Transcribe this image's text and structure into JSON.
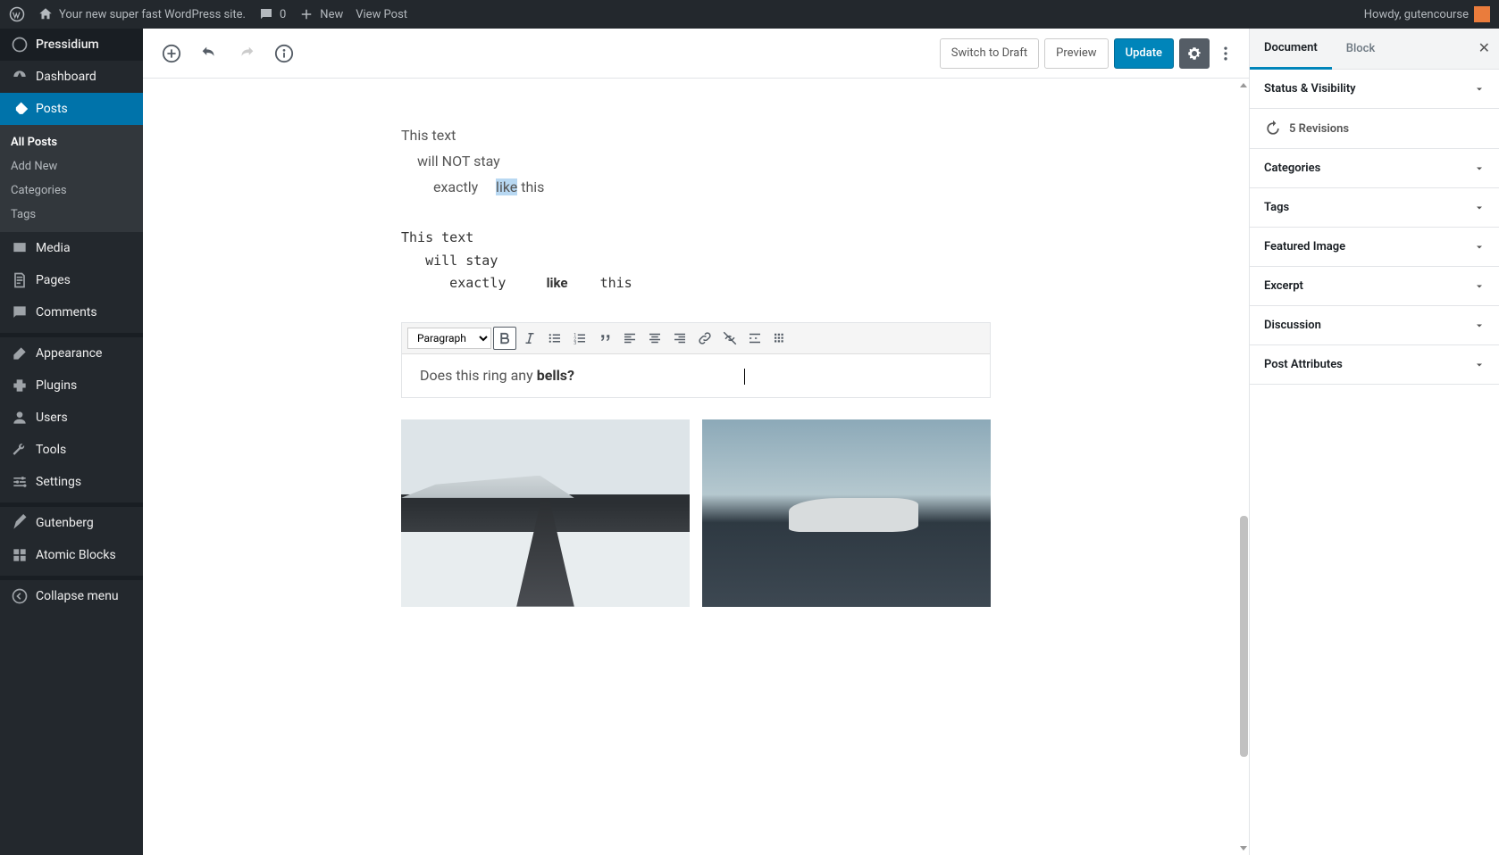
{
  "adminbar": {
    "site_name": "Your new super fast WordPress site.",
    "comments": "0",
    "new": "New",
    "view_post": "View Post",
    "howdy": "Howdy, gutencourse"
  },
  "sidebar": {
    "brand": "Pressidium",
    "items": [
      {
        "label": "Dashboard",
        "icon": "dashboard"
      },
      {
        "label": "Posts",
        "icon": "pin",
        "active": true,
        "subs": [
          {
            "label": "All Posts",
            "active": true
          },
          {
            "label": "Add New"
          },
          {
            "label": "Categories"
          },
          {
            "label": "Tags"
          }
        ]
      },
      {
        "label": "Media",
        "icon": "media"
      },
      {
        "label": "Pages",
        "icon": "pages"
      },
      {
        "label": "Comments",
        "icon": "comment"
      },
      {
        "label": "Appearance",
        "icon": "brush",
        "sep": true
      },
      {
        "label": "Plugins",
        "icon": "plug"
      },
      {
        "label": "Users",
        "icon": "user"
      },
      {
        "label": "Tools",
        "icon": "wrench"
      },
      {
        "label": "Settings",
        "icon": "sliders"
      },
      {
        "label": "Gutenberg",
        "icon": "pencil",
        "sep": true
      },
      {
        "label": "Atomic Blocks",
        "icon": "grid"
      },
      {
        "label": "Collapse menu",
        "icon": "collapse"
      }
    ]
  },
  "toolbar": {
    "switch_draft": "Switch to Draft",
    "preview": "Preview",
    "update": "Update"
  },
  "content": {
    "para1": {
      "l1": "This text",
      "l2": "will NOT stay",
      "l3a": "exactly",
      "l3b_hl": "like",
      "l3c": " this"
    },
    "verse": "This text\n   will stay\n      exactly     <b>like</b>    this",
    "classic": {
      "format": "Paragraph",
      "text_before": "Does this ring any ",
      "text_bold": "bells?"
    }
  },
  "settings": {
    "tabs": {
      "document": "Document",
      "block": "Block"
    },
    "sections": {
      "status": "Status & Visibility",
      "revisions": "5 Revisions",
      "categories": "Categories",
      "tags": "Tags",
      "featured": "Featured Image",
      "excerpt": "Excerpt",
      "discussion": "Discussion",
      "attrs": "Post Attributes"
    }
  }
}
